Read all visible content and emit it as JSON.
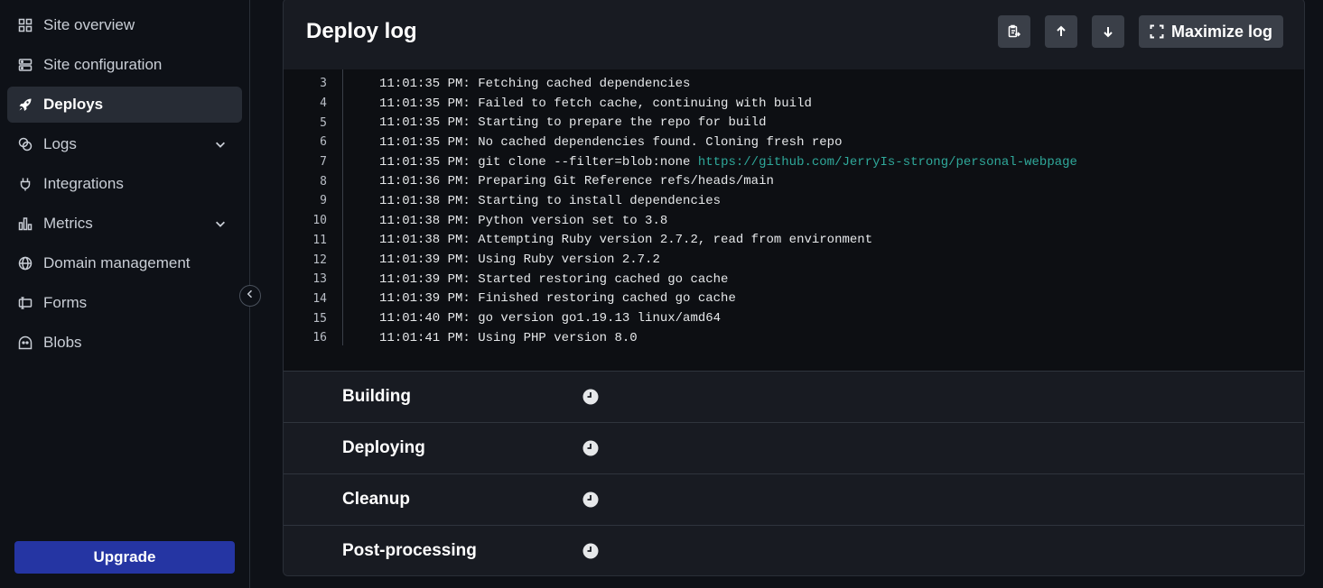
{
  "sidebar": {
    "items": [
      {
        "label": "Site overview",
        "icon": "grid-icon",
        "active": false,
        "chevron": false
      },
      {
        "label": "Site configuration",
        "icon": "config-icon",
        "active": false,
        "chevron": false
      },
      {
        "label": "Deploys",
        "icon": "rocket-icon",
        "active": true,
        "chevron": false
      },
      {
        "label": "Logs",
        "icon": "logs-icon",
        "active": false,
        "chevron": true
      },
      {
        "label": "Integrations",
        "icon": "plug-icon",
        "active": false,
        "chevron": false
      },
      {
        "label": "Metrics",
        "icon": "bar-chart-icon",
        "active": false,
        "chevron": true
      },
      {
        "label": "Domain management",
        "icon": "globe-icon",
        "active": false,
        "chevron": false
      },
      {
        "label": "Forms",
        "icon": "form-icon",
        "active": false,
        "chevron": false
      },
      {
        "label": "Blobs",
        "icon": "blob-icon",
        "active": false,
        "chevron": false
      }
    ],
    "upgrade_label": "Upgrade"
  },
  "deploy_log": {
    "title": "Deploy log",
    "maximize_label": "Maximize log",
    "lines": [
      {
        "n": "3",
        "text": "11:01:35 PM: Fetching cached dependencies"
      },
      {
        "n": "4",
        "text": "11:01:35 PM: Failed to fetch cache, continuing with build"
      },
      {
        "n": "5",
        "text": "11:01:35 PM: Starting to prepare the repo for build"
      },
      {
        "n": "6",
        "text": "11:01:35 PM: No cached dependencies found. Cloning fresh repo"
      },
      {
        "n": "7",
        "text": "11:01:35 PM: git clone --filter=blob:none ",
        "link": "https://github.com/JerryIs-strong/personal-webpage"
      },
      {
        "n": "8",
        "text": "11:01:36 PM: Preparing Git Reference refs/heads/main"
      },
      {
        "n": "9",
        "text": "11:01:38 PM: Starting to install dependencies"
      },
      {
        "n": "10",
        "text": "11:01:38 PM: Python version set to 3.8"
      },
      {
        "n": "11",
        "text": "11:01:38 PM: Attempting Ruby version 2.7.2, read from environment"
      },
      {
        "n": "12",
        "text": "11:01:39 PM: Using Ruby version 2.7.2"
      },
      {
        "n": "13",
        "text": "11:01:39 PM: Started restoring cached go cache"
      },
      {
        "n": "14",
        "text": "11:01:39 PM: Finished restoring cached go cache"
      },
      {
        "n": "15",
        "text": "11:01:40 PM: go version go1.19.13 linux/amd64"
      },
      {
        "n": "16",
        "text": "11:01:41 PM: Using PHP version 8.0"
      }
    ]
  },
  "steps": [
    {
      "label": "Building",
      "icon": "clock-icon"
    },
    {
      "label": "Deploying",
      "icon": "clock-icon"
    },
    {
      "label": "Cleanup",
      "icon": "clock-icon"
    },
    {
      "label": "Post-processing",
      "icon": "clock-icon"
    }
  ]
}
